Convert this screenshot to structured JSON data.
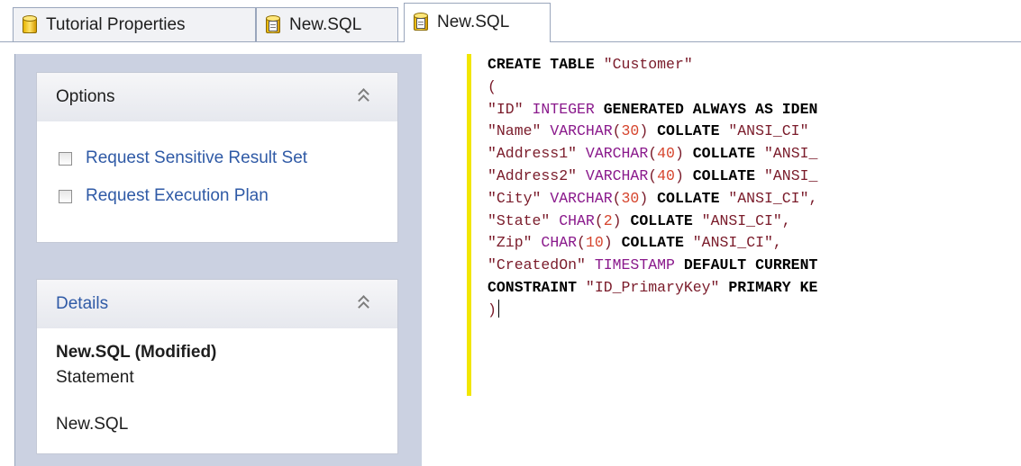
{
  "tabs": [
    {
      "label": "Tutorial Properties",
      "icon": "database-icon",
      "active": false
    },
    {
      "label": "New.SQL",
      "icon": "sql-document-icon",
      "active": false
    },
    {
      "label": "New.SQL",
      "icon": "sql-document-icon",
      "active": true
    }
  ],
  "options": {
    "title": "Options",
    "items": [
      {
        "label": "Request Sensitive Result Set",
        "checked": false
      },
      {
        "label": "Request Execution Plan",
        "checked": false
      }
    ]
  },
  "details": {
    "title": "Details",
    "name": "New.SQL (Modified)",
    "type": "Statement",
    "file": "New.SQL"
  },
  "editor": {
    "lines": [
      [
        {
          "t": "CREATE TABLE ",
          "c": "kw"
        },
        {
          "t": "\"Customer\"",
          "c": "str"
        }
      ],
      [
        {
          "t": "(",
          "c": "str"
        }
      ],
      [
        {
          "t": "\"ID\" ",
          "c": "str"
        },
        {
          "t": "INTEGER ",
          "c": "type"
        },
        {
          "t": "GENERATED ALWAYS AS IDEN",
          "c": "kw"
        }
      ],
      [
        {
          "t": "\"Name\" ",
          "c": "str"
        },
        {
          "t": "VARCHAR",
          "c": "type"
        },
        {
          "t": "(",
          "c": "str"
        },
        {
          "t": "30",
          "c": "num"
        },
        {
          "t": ") ",
          "c": "str"
        },
        {
          "t": "COLLATE ",
          "c": "kw"
        },
        {
          "t": "\"ANSI_CI\"",
          "c": "str"
        }
      ],
      [
        {
          "t": "\"Address1\" ",
          "c": "str"
        },
        {
          "t": "VARCHAR",
          "c": "type"
        },
        {
          "t": "(",
          "c": "str"
        },
        {
          "t": "40",
          "c": "num"
        },
        {
          "t": ") ",
          "c": "str"
        },
        {
          "t": "COLLATE ",
          "c": "kw"
        },
        {
          "t": "\"ANSI_",
          "c": "str"
        }
      ],
      [
        {
          "t": "\"Address2\" ",
          "c": "str"
        },
        {
          "t": "VARCHAR",
          "c": "type"
        },
        {
          "t": "(",
          "c": "str"
        },
        {
          "t": "40",
          "c": "num"
        },
        {
          "t": ") ",
          "c": "str"
        },
        {
          "t": "COLLATE ",
          "c": "kw"
        },
        {
          "t": "\"ANSI_",
          "c": "str"
        }
      ],
      [
        {
          "t": "\"City\" ",
          "c": "str"
        },
        {
          "t": "VARCHAR",
          "c": "type"
        },
        {
          "t": "(",
          "c": "str"
        },
        {
          "t": "30",
          "c": "num"
        },
        {
          "t": ") ",
          "c": "str"
        },
        {
          "t": "COLLATE ",
          "c": "kw"
        },
        {
          "t": "\"ANSI_CI\",",
          "c": "str"
        }
      ],
      [
        {
          "t": "\"State\" ",
          "c": "str"
        },
        {
          "t": "CHAR",
          "c": "type"
        },
        {
          "t": "(",
          "c": "str"
        },
        {
          "t": "2",
          "c": "num"
        },
        {
          "t": ") ",
          "c": "str"
        },
        {
          "t": "COLLATE ",
          "c": "kw"
        },
        {
          "t": "\"ANSI_CI\",",
          "c": "str"
        }
      ],
      [
        {
          "t": "\"Zip\" ",
          "c": "str"
        },
        {
          "t": "CHAR",
          "c": "type"
        },
        {
          "t": "(",
          "c": "str"
        },
        {
          "t": "10",
          "c": "num"
        },
        {
          "t": ") ",
          "c": "str"
        },
        {
          "t": "COLLATE ",
          "c": "kw"
        },
        {
          "t": "\"ANSI_CI\",",
          "c": "str"
        }
      ],
      [
        {
          "t": "\"CreatedOn\" ",
          "c": "str"
        },
        {
          "t": "TIMESTAMP ",
          "c": "type"
        },
        {
          "t": "DEFAULT CURRENT",
          "c": "kw"
        }
      ],
      [
        {
          "t": "CONSTRAINT ",
          "c": "kw"
        },
        {
          "t": "\"ID_PrimaryKey\" ",
          "c": "str"
        },
        {
          "t": "PRIMARY KE",
          "c": "kw"
        }
      ],
      [
        {
          "t": ")",
          "c": "str"
        }
      ]
    ]
  },
  "colors": {
    "keyword": "#000000",
    "string": "#7a1b2a",
    "type": "#8a1a8c",
    "number": "#d6452d",
    "change_bar": "#f2e600",
    "link": "#2f5aa6",
    "panel_bg": "#cbd1e1"
  }
}
